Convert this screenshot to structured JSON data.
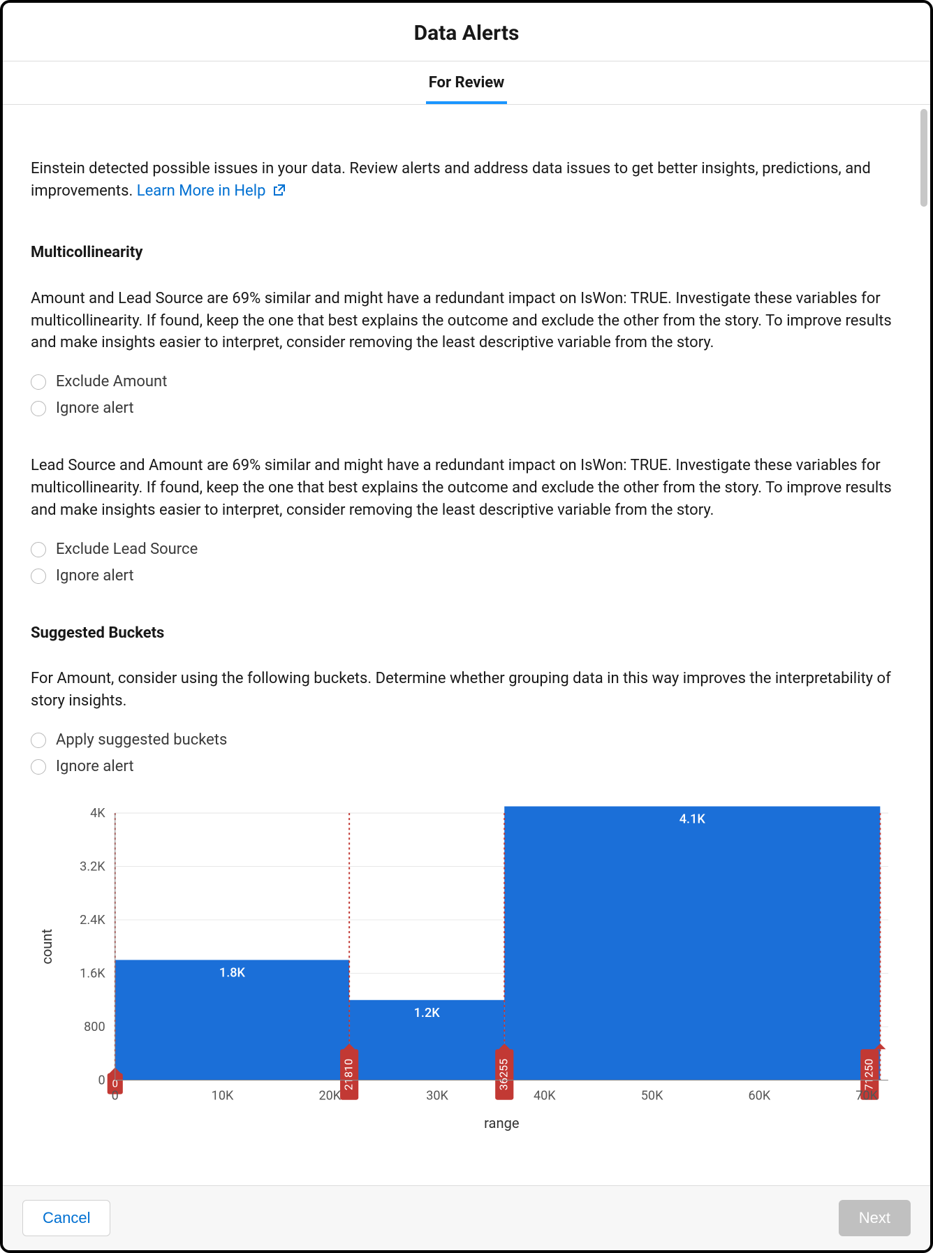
{
  "header": {
    "title": "Data Alerts"
  },
  "tabs": {
    "for_review": "For Review"
  },
  "intro": {
    "text": "Einstein detected possible issues in your data. Review alerts and address data issues to get better insights, predictions, and improvements. ",
    "learn_more": "Learn More in Help"
  },
  "multicollinearity": {
    "heading": "Multicollinearity",
    "alert1": {
      "text": "Amount and Lead Source are 69% similar and might have a redundant impact on IsWon: TRUE. Investigate these variables for multicollinearity. If found, keep the one that best explains the outcome and exclude the other from the story. To improve results and make insights easier to interpret, consider removing the least descriptive variable from the story.",
      "opt_exclude": "Exclude Amount",
      "opt_ignore": "Ignore alert"
    },
    "alert2": {
      "text": "Lead Source and Amount are 69% similar and might have a redundant impact on IsWon: TRUE. Investigate these variables for multicollinearity. If found, keep the one that best explains the outcome and exclude the other from the story. To improve results and make insights easier to interpret, consider removing the least descriptive variable from the story.",
      "opt_exclude": "Exclude Lead Source",
      "opt_ignore": "Ignore alert"
    }
  },
  "buckets": {
    "heading": "Suggested Buckets",
    "text": "For Amount, consider using the following buckets. Determine whether grouping data in this way improves the interpretability of story insights.",
    "opt_apply": "Apply suggested buckets",
    "opt_ignore": "Ignore alert"
  },
  "chart_data": {
    "type": "bar",
    "title": "",
    "xlabel": "range",
    "ylabel": "count",
    "x_ticks": [
      "0",
      "10K",
      "20K",
      "30K",
      "40K",
      "50K",
      "60K",
      "70K"
    ],
    "y_ticks": [
      "0",
      "800",
      "1.6K",
      "2.4K",
      "3.2K",
      "4K"
    ],
    "ylim": [
      0,
      4000
    ],
    "xlim": [
      0,
      72000
    ],
    "bars": [
      {
        "x0": 0,
        "x1": 21810,
        "value": 1800,
        "label": "1.8K"
      },
      {
        "x0": 21810,
        "x1": 36255,
        "value": 1200,
        "label": "1.2K"
      },
      {
        "x0": 36255,
        "x1": 71250,
        "value": 4100,
        "label": "4.1K"
      }
    ],
    "boundary_markers": [
      {
        "x": 0,
        "label": "0"
      },
      {
        "x": 21810,
        "label": "21810"
      },
      {
        "x": 36255,
        "label": "36255"
      },
      {
        "x": 71250,
        "label": "71250"
      }
    ],
    "colors": {
      "bar": "#1b6fd8",
      "marker": "#c23934",
      "axis": "#555",
      "grid": "#e8e8e8"
    }
  },
  "footer": {
    "cancel": "Cancel",
    "next": "Next"
  }
}
